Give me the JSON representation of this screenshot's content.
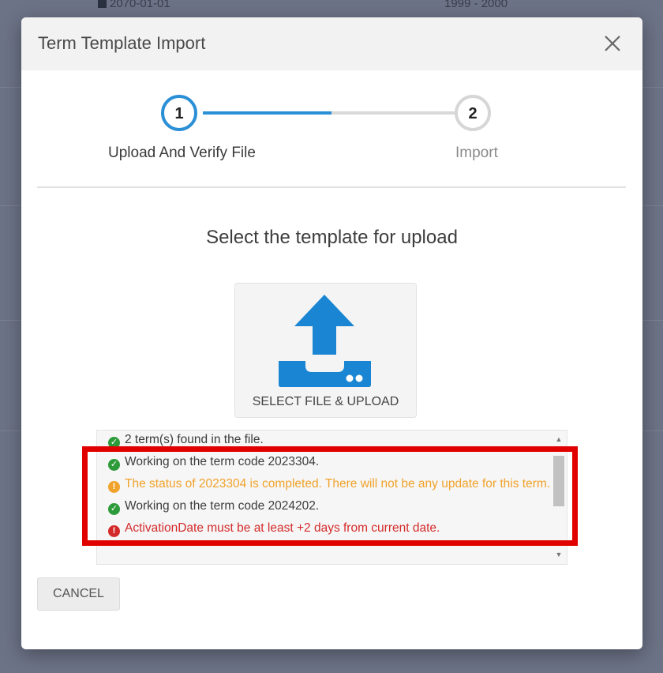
{
  "background": {
    "left_text": "2070-01-01",
    "right_text": "1999 - 2000"
  },
  "dialog": {
    "title": "Term Template Import",
    "close_icon": "close-icon"
  },
  "stepper": {
    "steps": [
      {
        "number": "1",
        "label": "Upload And Verify File",
        "state": "active"
      },
      {
        "number": "2",
        "label": "Import",
        "state": "inactive"
      }
    ],
    "progress": 0.5,
    "accent_color": "#2b8fd6"
  },
  "upload": {
    "heading": "Select the template for upload",
    "button_label": "SELECT FILE & UPLOAD",
    "icon": "upload-tray-icon",
    "icon_color": "#1a86d3"
  },
  "log": {
    "lines": [
      {
        "status": "ok",
        "icon": "check-circle-icon",
        "text": "2 term(s) found in the file."
      },
      {
        "status": "ok",
        "icon": "check-circle-icon",
        "text": "Working on the term code 2023304."
      },
      {
        "status": "warn",
        "icon": "exclamation-circle-icon",
        "text": "The status of 2023304 is completed. There will not be any update for this term."
      },
      {
        "status": "ok",
        "icon": "check-circle-icon",
        "text": "Working on the term code 2024202."
      },
      {
        "status": "err",
        "icon": "exclamation-circle-icon",
        "text": "ActivationDate must be at least +2 days from current date."
      }
    ],
    "colors": {
      "ok": "#2e9b3a",
      "warn": "#f0a22a",
      "err": "#d42a2a"
    }
  },
  "highlight_color": "#e10000",
  "footer": {
    "cancel_label": "CANCEL"
  }
}
